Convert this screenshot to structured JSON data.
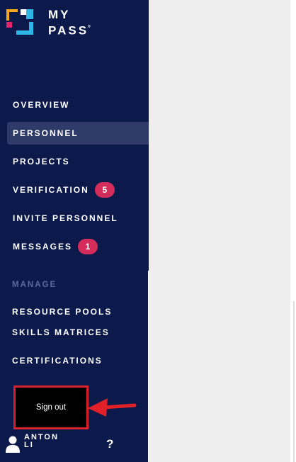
{
  "brand": {
    "line1": "MY",
    "line2": "PASS",
    "mark": "®"
  },
  "nav": {
    "overview": "OVERVIEW",
    "personnel": "PERSONNEL",
    "projects": "PROJECTS",
    "verification": "VERIFICATION",
    "verification_badge": "5",
    "invite": "INVITE PERSONNEL",
    "messages": "MESSAGES",
    "messages_badge": "1",
    "active": "personnel"
  },
  "manage": {
    "label": "MANAGE",
    "resource_pools": "RESOURCE POOLS",
    "skills_matrices": "SKILLS MATRICES",
    "certifications": "CERTIFICATIONS"
  },
  "signout": {
    "label": "Sign out"
  },
  "user": {
    "first": "ANTON",
    "last": "LI",
    "icon": "user-icon"
  },
  "help": {
    "label": "?",
    "icon": "help-icon"
  },
  "colors": {
    "sidebar": "#0c1a4b",
    "active_bg": "#2e3b68",
    "badge": "#d42d5b",
    "highlight": "#d9212b",
    "content_bg": "#eeeeee"
  }
}
